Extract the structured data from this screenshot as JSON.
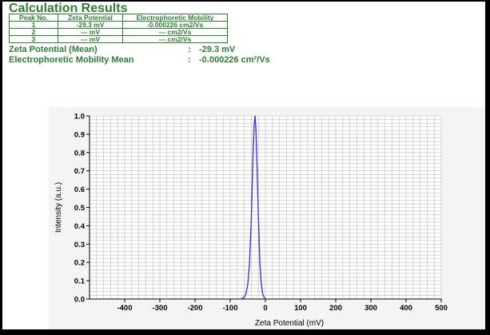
{
  "results": {
    "title": "Calculation Results",
    "table": {
      "headers": [
        "Peak No.",
        "Zeta Potential",
        "Electrophoretic Mobility"
      ],
      "rows": [
        [
          "1",
          "-29.3 mV",
          "-0.000226 cm2/Vs"
        ],
        [
          "2",
          "--- mV",
          "--- cm2/Vs"
        ],
        [
          "3",
          "--- mV",
          "--- cm2/Vs"
        ]
      ]
    },
    "zeta_mean_label": "Zeta Potential (Mean)",
    "zeta_mean_colon": ":",
    "zeta_mean_value": "-29.3 mV",
    "mobility_mean_label": "Electrophoretic Mobility Mean",
    "mobility_mean_colon": ":",
    "mobility_mean_value": "-0.000226 cm²/Vs"
  },
  "chart_data": {
    "type": "line",
    "title": "",
    "xlabel": "Zeta Potential (mV)",
    "ylabel": "Intensity (a.u.)",
    "xlim": [
      -500,
      500
    ],
    "ylim": [
      0,
      1.0
    ],
    "xticks": [
      -400,
      -300,
      -200,
      -100,
      0,
      100,
      200,
      300,
      400,
      500
    ],
    "yticks": [
      0.0,
      0.1,
      0.2,
      0.3,
      0.4,
      0.5,
      0.6,
      0.7,
      0.8,
      0.9,
      1.0
    ],
    "grid": true,
    "line_color": "#3a3ad6",
    "series": [
      {
        "x": [
          -70,
          -60,
          -55,
          -50,
          -45,
          -40,
          -35,
          -32,
          -29.3,
          -27,
          -24,
          -20,
          -16,
          -12,
          -8,
          -4,
          0
        ],
        "values": [
          0.0,
          0.01,
          0.03,
          0.08,
          0.2,
          0.44,
          0.8,
          0.95,
          1.0,
          0.93,
          0.74,
          0.46,
          0.21,
          0.09,
          0.03,
          0.01,
          0.0
        ]
      }
    ]
  }
}
